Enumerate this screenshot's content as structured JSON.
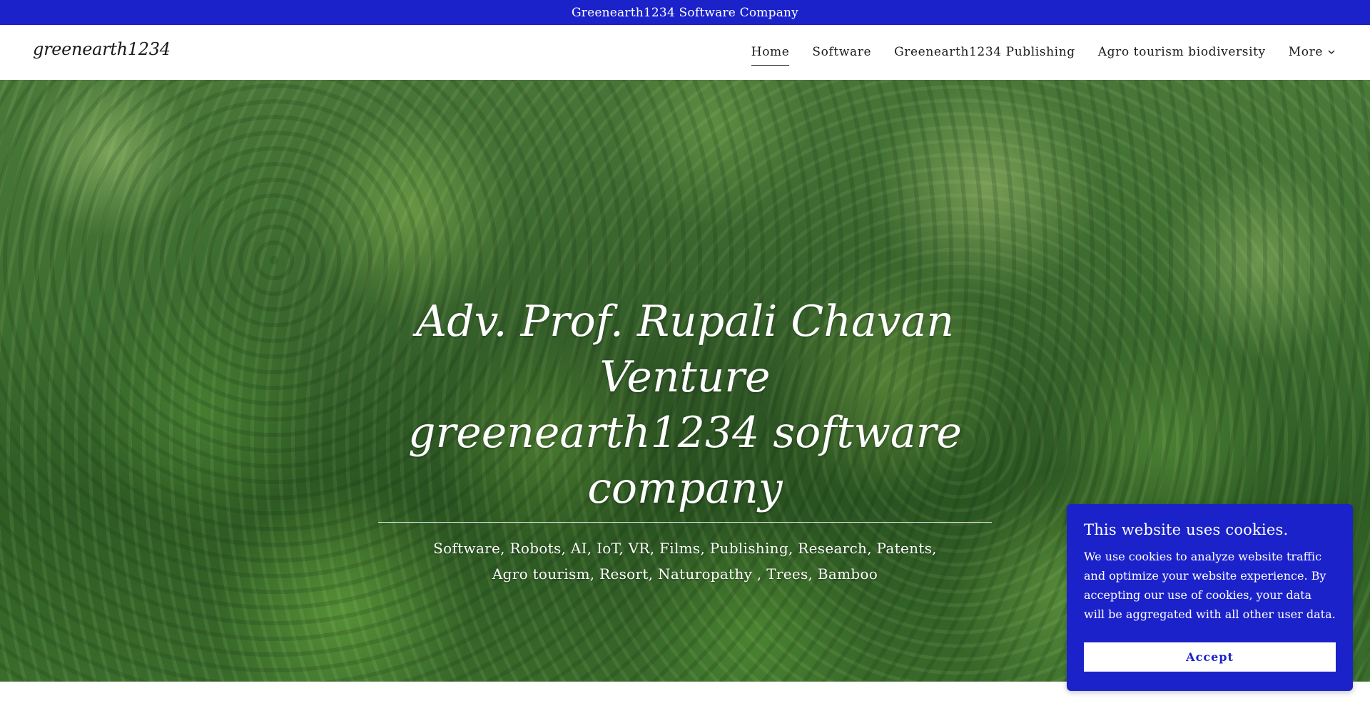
{
  "announcement": {
    "text": "Greenearth1234 Software Company"
  },
  "header": {
    "logo": "greenearth1234",
    "nav": [
      {
        "label": "Home",
        "active": true
      },
      {
        "label": "Software"
      },
      {
        "label": "Greenearth1234 Publishing"
      },
      {
        "label": "Agro tourism biodiversity"
      },
      {
        "label": "More",
        "icon": "chevron-down-icon"
      }
    ]
  },
  "hero": {
    "title_line1": "Adv. Prof. Rupali Chavan Venture",
    "title_line2": "greenearth1234 software company",
    "subtitle": "Software,  Robots,  AI, IoT, VR, Films, Publishing, Research, Patents, Agro tourism, Resort, Naturopathy , Trees, Bamboo",
    "background": "forest-canopy-image"
  },
  "cookie_banner": {
    "title": "This website uses cookies.",
    "body": "We use cookies to analyze website traffic and optimize your website experience. By accepting our use of cookies, your data will be aggregated with all other user data.",
    "accept_label": "Accept"
  },
  "colors": {
    "brand_blue": "#1b22c9",
    "text_dark": "#1a1a1a",
    "white": "#ffffff"
  }
}
